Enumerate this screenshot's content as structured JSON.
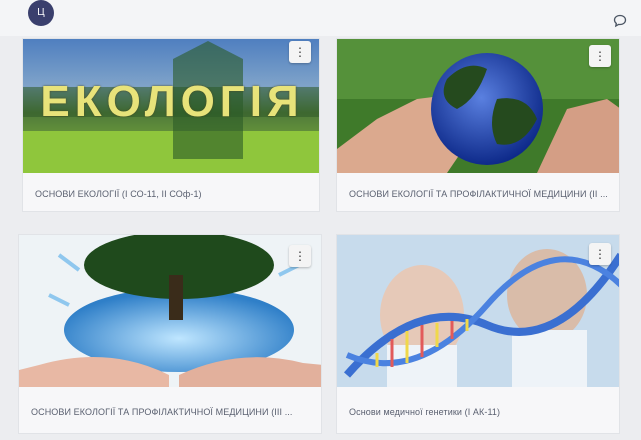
{
  "topbar": {
    "avatar_text": "Ц",
    "chat_icon": "chat-icon"
  },
  "courses": [
    {
      "title": "ОСНОВИ ЕКОЛОГІЇ (І СО-11, ІІ СОф-1)",
      "image_word": "ЕКОЛОГІЯ",
      "menu": "⋮"
    },
    {
      "title": "ОСНОВИ ЕКОЛОГІЇ ТА ПРОФІЛАКТИЧНОЇ МЕДИЦИНИ (ІІ ...",
      "menu": "⋮"
    },
    {
      "title": "ОСНОВИ ЕКОЛОГІЇ ТА ПРОФІЛАКТИЧНОЇ МЕДИЦИНИ (ІІІ ...",
      "menu": "⋮"
    },
    {
      "title": "Основи медичної генетики (І АК-11)",
      "menu": "⋮"
    }
  ],
  "colors": {
    "background": "#ecedf0",
    "avatar": "#3a3f6d",
    "title_text": "#5a6070"
  }
}
